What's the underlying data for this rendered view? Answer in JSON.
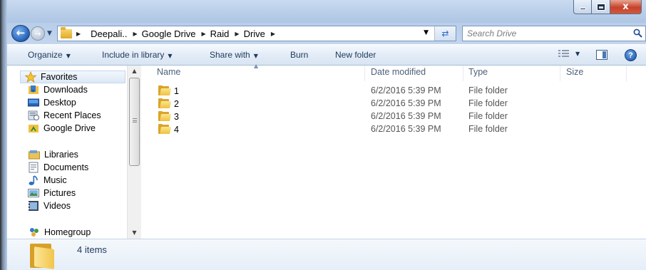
{
  "window": {
    "close_glyph": "x",
    "minimize_icon": "minimize-icon",
    "maximize_icon": "maximize-icon"
  },
  "address": {
    "breadcrumbs": [
      "Deepali..",
      "Google Drive",
      "Raid",
      "Drive"
    ],
    "back_icon": "back-arrow-icon",
    "forward_icon": "forward-arrow-icon",
    "refresh_icon": "refresh-icon"
  },
  "search": {
    "placeholder": "Search Drive",
    "icon": "search-icon"
  },
  "toolbar": {
    "organize": "Organize",
    "include_in_library": "Include in library",
    "share_with": "Share with",
    "burn": "Burn",
    "new_folder": "New folder",
    "help_glyph": "?"
  },
  "nav": {
    "favorites": "Favorites",
    "favorites_items": [
      "Downloads",
      "Desktop",
      "Recent Places",
      "Google Drive"
    ],
    "libraries": "Libraries",
    "libraries_items": [
      "Documents",
      "Music",
      "Pictures",
      "Videos"
    ],
    "homegroup": "Homegroup"
  },
  "columns": {
    "name": "Name",
    "date_modified": "Date modified",
    "type": "Type",
    "size": "Size"
  },
  "files": [
    {
      "name": "1",
      "date_modified": "6/2/2016 5:39 PM",
      "type": "File folder",
      "size": ""
    },
    {
      "name": "2",
      "date_modified": "6/2/2016 5:39 PM",
      "type": "File folder",
      "size": ""
    },
    {
      "name": "3",
      "date_modified": "6/2/2016 5:39 PM",
      "type": "File folder",
      "size": ""
    },
    {
      "name": "4",
      "date_modified": "6/2/2016 5:39 PM",
      "type": "File folder",
      "size": ""
    }
  ],
  "status": {
    "item_count": "4 items"
  },
  "colors": {
    "accent": "#1e395b",
    "frame": "#b8cde8",
    "folder": "#f0c13f"
  }
}
